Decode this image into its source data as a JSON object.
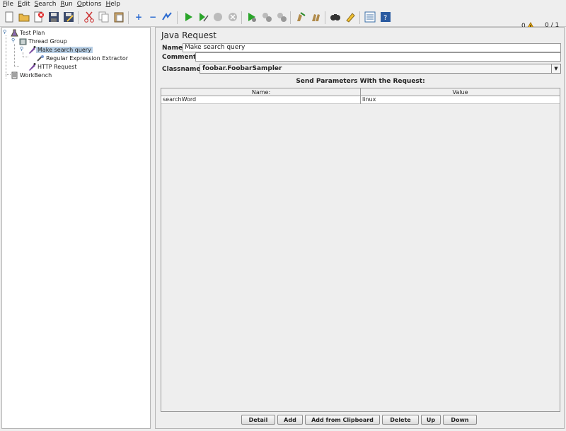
{
  "menu": [
    {
      "u": "F",
      "rest": "ile"
    },
    {
      "u": "E",
      "rest": "dit"
    },
    {
      "u": "S",
      "rest": "earch"
    },
    {
      "u": "R",
      "rest": "un"
    },
    {
      "u": "O",
      "rest": "ptions"
    },
    {
      "u": "H",
      "rest": "elp"
    }
  ],
  "toolbar": {
    "icons": [
      "new-icon",
      "open-icon",
      "close-icon",
      "save-icon",
      "save-as-icon",
      "cut-icon",
      "copy-icon",
      "paste-icon",
      "expand-icon",
      "collapse-icon",
      "toggle-icon",
      "start-icon",
      "start-no-pauses-icon",
      "stop-icon",
      "shutdown-icon",
      "remote-start-icon",
      "remote-stop-icon",
      "remote-shutdown-icon",
      "clear-icon",
      "clear-all-icon",
      "search-icon",
      "reset-search-icon",
      "function-helper-icon",
      "help-icon"
    ],
    "warning_count": "0",
    "threads": "0 / 1"
  },
  "tree": {
    "test_plan": "Test Plan",
    "thread_group": "Thread Group",
    "make_search_query": "Make search query",
    "regex_extractor": "Regular Expression Extractor",
    "http_request": "HTTP Request",
    "workbench": "WorkBench"
  },
  "form": {
    "title": "Java Request",
    "name_label": "Name:",
    "name_value": "Make search query",
    "comments_label": "Comments:",
    "comments_value": "",
    "classname_label": "Classname:",
    "classname_value": "foobar.FoobarSampler",
    "params_title": "Send Parameters With the Request:",
    "columns": [
      "Name:",
      "Value"
    ],
    "rows": [
      {
        "name": "searchWord",
        "value": "linux"
      }
    ]
  },
  "buttons": {
    "detail": "Detail",
    "add": "Add",
    "add_clipboard": "Add from Clipboard",
    "delete": "Delete",
    "up": "Up",
    "down": "Down"
  },
  "colors": {
    "selection": "#b8cfe5",
    "background": "#eeeeee"
  }
}
